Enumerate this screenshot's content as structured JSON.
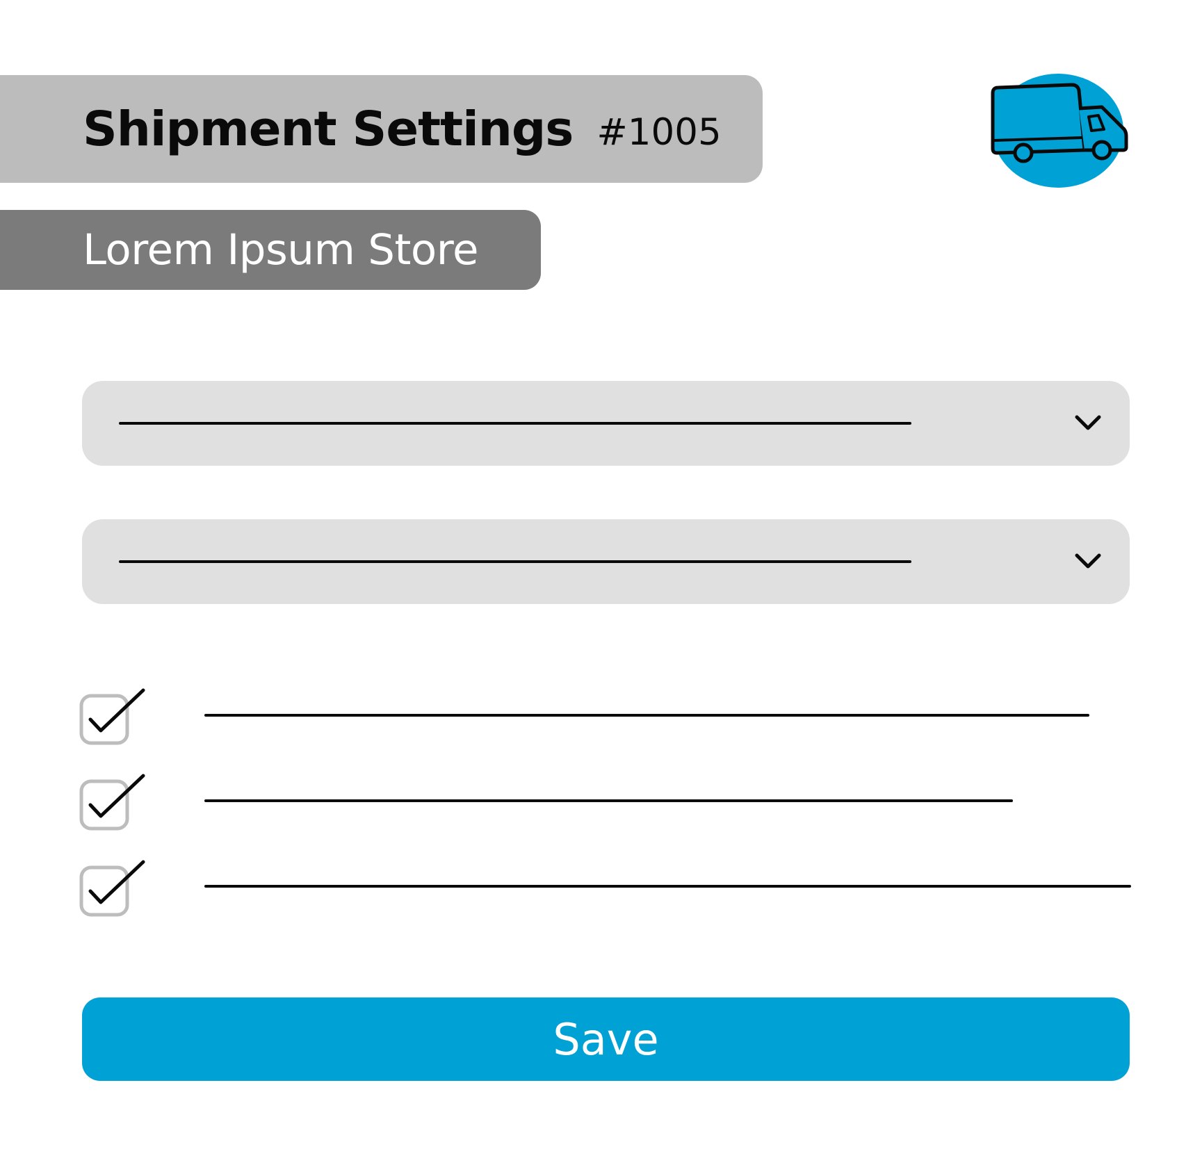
{
  "header": {
    "title": "Shipment Settings",
    "shipment_id": "#1005",
    "store_name": "Lorem Ipsum Store"
  },
  "icons": {
    "header_icon": "truck-icon",
    "dropdown_icon": "chevron-down-icon",
    "checkbox_icon": "checkmark-icon"
  },
  "dropdowns": [
    {
      "value": ""
    },
    {
      "value": ""
    }
  ],
  "options": [
    {
      "checked": true,
      "label": ""
    },
    {
      "checked": true,
      "label": ""
    },
    {
      "checked": true,
      "label": ""
    }
  ],
  "actions": {
    "save_label": "Save"
  },
  "colors": {
    "accent": "#00a1d5",
    "title_bar": "#bcbcbc",
    "store_bar": "#7b7b7b",
    "field_bg": "#e0e0e0",
    "checkbox_border": "#bdbdbd"
  }
}
